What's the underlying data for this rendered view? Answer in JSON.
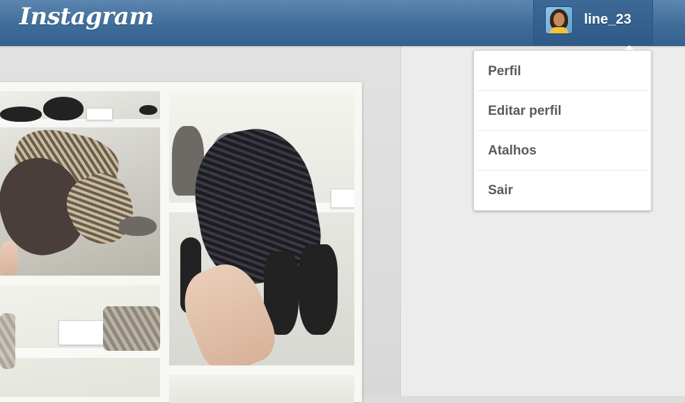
{
  "header": {
    "logo_text": "Instagram",
    "username": "line_23",
    "avatar_icon": "user-avatar-icon",
    "colors": {
      "bar": "#3f6d99",
      "text": "#ffffff"
    }
  },
  "user_menu": {
    "items": [
      {
        "label": "Perfil"
      },
      {
        "label": "Editar perfil"
      },
      {
        "label": "Atalhos"
      },
      {
        "label": "Sair"
      }
    ]
  },
  "feed": {
    "photos": [
      "shoes-photo",
      "black-bootie-photo",
      "handbag-photo",
      "partial-photo"
    ]
  }
}
